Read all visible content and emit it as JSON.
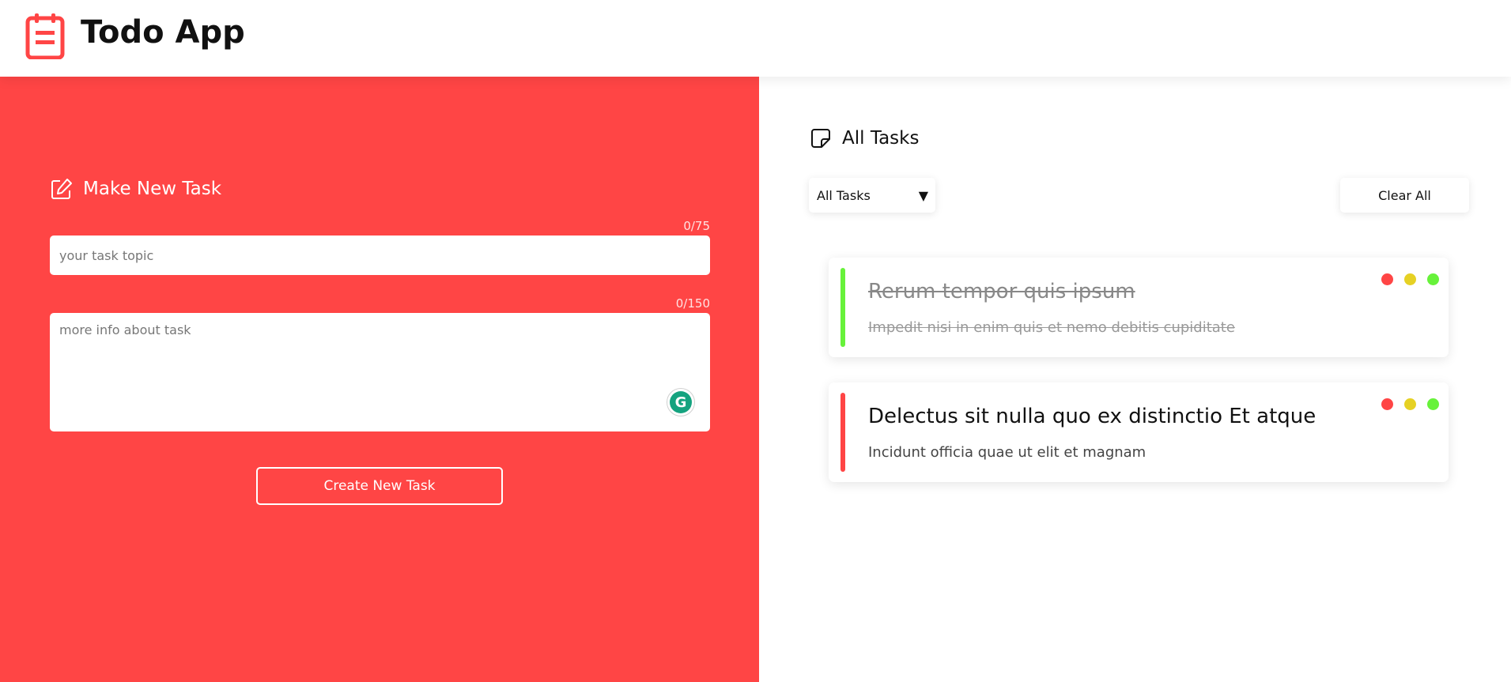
{
  "app": {
    "title": "Todo App",
    "logo_icon": "clipboard-icon"
  },
  "colors": {
    "accent": "#ff4545",
    "red": "#ff4545",
    "yellow": "#e6d124",
    "green": "#67f23a"
  },
  "form": {
    "heading": "Make New Task",
    "heading_icon": "edit-icon",
    "topic": {
      "placeholder": "your task topic",
      "value": "",
      "counter": "0/75"
    },
    "info": {
      "placeholder": "more info about task",
      "value": "",
      "counter": "0/150"
    },
    "submit_label": "Create New Task"
  },
  "tasks_panel": {
    "heading": "All Tasks",
    "heading_icon": "sticky-note-icon",
    "filter": {
      "selected": "All Tasks",
      "arrow": "▼"
    },
    "clear_label": "Clear All",
    "tasks": [
      {
        "title": "Rerum tempor quis ipsum",
        "description": "Impedit nisi in enim quis et nemo debitis cupiditate",
        "status": "done",
        "bar_color": "#67f23a"
      },
      {
        "title": "Delectus sit nulla quo ex distinctio Et atque",
        "description": "Incidunt officia quae ut elit et magnam",
        "status": "pending",
        "bar_color": "#ff4545"
      }
    ]
  }
}
